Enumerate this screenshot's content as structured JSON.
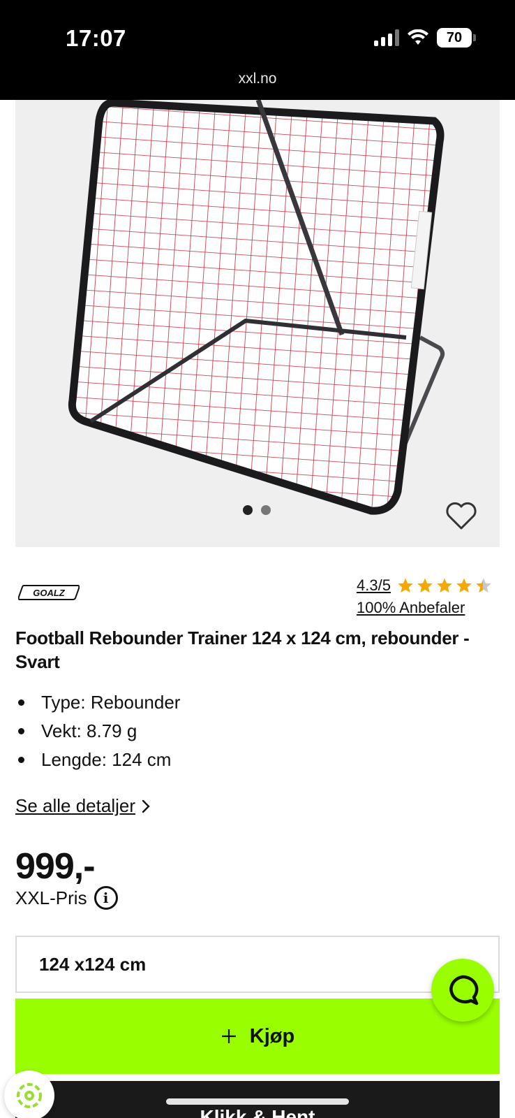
{
  "status_bar": {
    "time": "17:07",
    "battery": "70",
    "url": "xxl.no"
  },
  "gallery": {
    "image_alt": "Football rebounder net",
    "dot_count": 2,
    "active_index": 0
  },
  "product": {
    "brand": "GOALZ",
    "rating": "4.3/5",
    "rating_value": 4.3,
    "recommend": "100% Anbefaler",
    "title": "Football Rebounder Trainer 124 x 124 cm, rebounder - Svart",
    "specs": [
      "Type: Rebounder",
      "Vekt: 8.79 g",
      "Lengde: 124 cm"
    ],
    "details_link": "Se alle detaljer",
    "price": "999,-",
    "price_label": "XXL-Pris",
    "size": "124 x124 cm"
  },
  "actions": {
    "buy": "Kjøp",
    "click_collect": "Klikk & Hent"
  },
  "colors": {
    "accent": "#99ff00",
    "star": "#f5a800",
    "dark": "#1a1a1a"
  }
}
